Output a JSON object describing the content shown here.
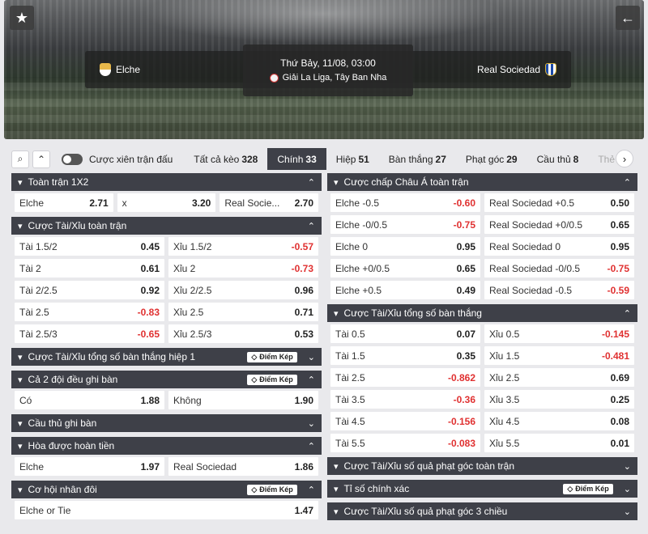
{
  "header": {
    "home_team": "Elche",
    "away_team": "Real Sociedad",
    "date": "Thứ Bảy, 11/08, 03:00",
    "league": "Giải La Liga, Tây Ban Nha",
    "colors": {
      "accent_dark": "#3e4048",
      "negative": "#e03131"
    }
  },
  "filter": {
    "combo_label": "Cược xiên trận đấu",
    "tabs": [
      {
        "label": "Tất cả kèo",
        "count": "328"
      },
      {
        "label": "Chính",
        "count": "33"
      },
      {
        "label": "Hiệp",
        "count": "51"
      },
      {
        "label": "Bàn thắng",
        "count": "27"
      },
      {
        "label": "Phạt góc",
        "count": "29"
      },
      {
        "label": "Cầu thủ",
        "count": "8"
      },
      {
        "label": "Thẻ",
        "count": ""
      }
    ]
  },
  "badge_label": "Điểm Kép",
  "left": {
    "s1": {
      "title": "Toàn trận 1X2",
      "cells": [
        [
          "Elche",
          "2.71"
        ],
        [
          "x",
          "3.20"
        ],
        [
          "Real Socie...",
          "2.70"
        ]
      ]
    },
    "s2": {
      "title": "Cược Tài/Xỉu toàn trận",
      "rows": [
        [
          [
            "Tài 1.5/2",
            "0.45"
          ],
          [
            "Xỉu 1.5/2",
            "-0.57"
          ]
        ],
        [
          [
            "Tài 2",
            "0.61"
          ],
          [
            "Xỉu 2",
            "-0.73"
          ]
        ],
        [
          [
            "Tài 2/2.5",
            "0.92"
          ],
          [
            "Xỉu 2/2.5",
            "0.96"
          ]
        ],
        [
          [
            "Tài 2.5",
            "-0.83"
          ],
          [
            "Xỉu 2.5",
            "0.71"
          ]
        ],
        [
          [
            "Tài 2.5/3",
            "-0.65"
          ],
          [
            "Xỉu 2.5/3",
            "0.53"
          ]
        ]
      ]
    },
    "s3": {
      "title": "Cược Tài/Xỉu tổng số bàn thắng hiệp 1"
    },
    "s4": {
      "title": "Cả 2 đội đều ghi bàn",
      "rows": [
        [
          [
            "Có",
            "1.88"
          ],
          [
            "Không",
            "1.90"
          ]
        ]
      ]
    },
    "s5": {
      "title": "Cầu thủ ghi bàn"
    },
    "s6": {
      "title": "Hòa được hoàn tiền",
      "rows": [
        [
          [
            "Elche",
            "1.97"
          ],
          [
            "Real Sociedad",
            "1.86"
          ]
        ]
      ]
    },
    "s7": {
      "title": "Cơ hội nhân đôi",
      "rows": [
        [
          [
            "Elche or Tie",
            "1.47"
          ]
        ]
      ]
    }
  },
  "right": {
    "s1": {
      "title": "Cược chấp Châu Á toàn trận",
      "rows": [
        [
          [
            "Elche -0.5",
            "-0.60"
          ],
          [
            "Real Sociedad +0.5",
            "0.50"
          ]
        ],
        [
          [
            "Elche -0/0.5",
            "-0.75"
          ],
          [
            "Real Sociedad +0/0.5",
            "0.65"
          ]
        ],
        [
          [
            "Elche 0",
            "0.95"
          ],
          [
            "Real Sociedad 0",
            "0.95"
          ]
        ],
        [
          [
            "Elche +0/0.5",
            "0.65"
          ],
          [
            "Real Sociedad -0/0.5",
            "-0.75"
          ]
        ],
        [
          [
            "Elche +0.5",
            "0.49"
          ],
          [
            "Real Sociedad -0.5",
            "-0.59"
          ]
        ]
      ]
    },
    "s2": {
      "title": "Cược Tài/Xỉu tổng số bàn thắng",
      "rows": [
        [
          [
            "Tài 0.5",
            "0.07"
          ],
          [
            "Xỉu 0.5",
            "-0.145"
          ]
        ],
        [
          [
            "Tài 1.5",
            "0.35"
          ],
          [
            "Xỉu 1.5",
            "-0.481"
          ]
        ],
        [
          [
            "Tài 2.5",
            "-0.862"
          ],
          [
            "Xỉu 2.5",
            "0.69"
          ]
        ],
        [
          [
            "Tài 3.5",
            "-0.36"
          ],
          [
            "Xỉu 3.5",
            "0.25"
          ]
        ],
        [
          [
            "Tài 4.5",
            "-0.156"
          ],
          [
            "Xỉu 4.5",
            "0.08"
          ]
        ],
        [
          [
            "Tài 5.5",
            "-0.083"
          ],
          [
            "Xỉu 5.5",
            "0.01"
          ]
        ]
      ]
    },
    "s3": {
      "title": "Cược Tài/Xỉu số quả phạt góc toàn trận"
    },
    "s4": {
      "title": "Tỉ số chính xác"
    },
    "s5": {
      "title": "Cược Tài/Xỉu số quả phạt góc 3 chiều"
    }
  }
}
